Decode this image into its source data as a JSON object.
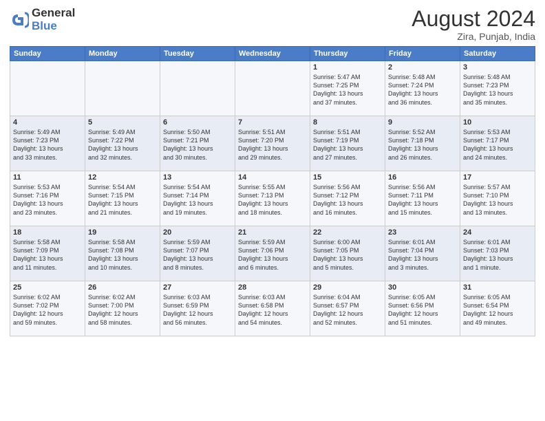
{
  "header": {
    "logo_line1": "General",
    "logo_line2": "Blue",
    "month": "August 2024",
    "location": "Zira, Punjab, India"
  },
  "weekdays": [
    "Sunday",
    "Monday",
    "Tuesday",
    "Wednesday",
    "Thursday",
    "Friday",
    "Saturday"
  ],
  "weeks": [
    [
      {
        "day": "",
        "info": ""
      },
      {
        "day": "",
        "info": ""
      },
      {
        "day": "",
        "info": ""
      },
      {
        "day": "",
        "info": ""
      },
      {
        "day": "1",
        "info": "Sunrise: 5:47 AM\nSunset: 7:25 PM\nDaylight: 13 hours\nand 37 minutes."
      },
      {
        "day": "2",
        "info": "Sunrise: 5:48 AM\nSunset: 7:24 PM\nDaylight: 13 hours\nand 36 minutes."
      },
      {
        "day": "3",
        "info": "Sunrise: 5:48 AM\nSunset: 7:23 PM\nDaylight: 13 hours\nand 35 minutes."
      }
    ],
    [
      {
        "day": "4",
        "info": "Sunrise: 5:49 AM\nSunset: 7:23 PM\nDaylight: 13 hours\nand 33 minutes."
      },
      {
        "day": "5",
        "info": "Sunrise: 5:49 AM\nSunset: 7:22 PM\nDaylight: 13 hours\nand 32 minutes."
      },
      {
        "day": "6",
        "info": "Sunrise: 5:50 AM\nSunset: 7:21 PM\nDaylight: 13 hours\nand 30 minutes."
      },
      {
        "day": "7",
        "info": "Sunrise: 5:51 AM\nSunset: 7:20 PM\nDaylight: 13 hours\nand 29 minutes."
      },
      {
        "day": "8",
        "info": "Sunrise: 5:51 AM\nSunset: 7:19 PM\nDaylight: 13 hours\nand 27 minutes."
      },
      {
        "day": "9",
        "info": "Sunrise: 5:52 AM\nSunset: 7:18 PM\nDaylight: 13 hours\nand 26 minutes."
      },
      {
        "day": "10",
        "info": "Sunrise: 5:53 AM\nSunset: 7:17 PM\nDaylight: 13 hours\nand 24 minutes."
      }
    ],
    [
      {
        "day": "11",
        "info": "Sunrise: 5:53 AM\nSunset: 7:16 PM\nDaylight: 13 hours\nand 23 minutes."
      },
      {
        "day": "12",
        "info": "Sunrise: 5:54 AM\nSunset: 7:15 PM\nDaylight: 13 hours\nand 21 minutes."
      },
      {
        "day": "13",
        "info": "Sunrise: 5:54 AM\nSunset: 7:14 PM\nDaylight: 13 hours\nand 19 minutes."
      },
      {
        "day": "14",
        "info": "Sunrise: 5:55 AM\nSunset: 7:13 PM\nDaylight: 13 hours\nand 18 minutes."
      },
      {
        "day": "15",
        "info": "Sunrise: 5:56 AM\nSunset: 7:12 PM\nDaylight: 13 hours\nand 16 minutes."
      },
      {
        "day": "16",
        "info": "Sunrise: 5:56 AM\nSunset: 7:11 PM\nDaylight: 13 hours\nand 15 minutes."
      },
      {
        "day": "17",
        "info": "Sunrise: 5:57 AM\nSunset: 7:10 PM\nDaylight: 13 hours\nand 13 minutes."
      }
    ],
    [
      {
        "day": "18",
        "info": "Sunrise: 5:58 AM\nSunset: 7:09 PM\nDaylight: 13 hours\nand 11 minutes."
      },
      {
        "day": "19",
        "info": "Sunrise: 5:58 AM\nSunset: 7:08 PM\nDaylight: 13 hours\nand 10 minutes."
      },
      {
        "day": "20",
        "info": "Sunrise: 5:59 AM\nSunset: 7:07 PM\nDaylight: 13 hours\nand 8 minutes."
      },
      {
        "day": "21",
        "info": "Sunrise: 5:59 AM\nSunset: 7:06 PM\nDaylight: 13 hours\nand 6 minutes."
      },
      {
        "day": "22",
        "info": "Sunrise: 6:00 AM\nSunset: 7:05 PM\nDaylight: 13 hours\nand 5 minutes."
      },
      {
        "day": "23",
        "info": "Sunrise: 6:01 AM\nSunset: 7:04 PM\nDaylight: 13 hours\nand 3 minutes."
      },
      {
        "day": "24",
        "info": "Sunrise: 6:01 AM\nSunset: 7:03 PM\nDaylight: 13 hours\nand 1 minute."
      }
    ],
    [
      {
        "day": "25",
        "info": "Sunrise: 6:02 AM\nSunset: 7:02 PM\nDaylight: 12 hours\nand 59 minutes."
      },
      {
        "day": "26",
        "info": "Sunrise: 6:02 AM\nSunset: 7:00 PM\nDaylight: 12 hours\nand 58 minutes."
      },
      {
        "day": "27",
        "info": "Sunrise: 6:03 AM\nSunset: 6:59 PM\nDaylight: 12 hours\nand 56 minutes."
      },
      {
        "day": "28",
        "info": "Sunrise: 6:03 AM\nSunset: 6:58 PM\nDaylight: 12 hours\nand 54 minutes."
      },
      {
        "day": "29",
        "info": "Sunrise: 6:04 AM\nSunset: 6:57 PM\nDaylight: 12 hours\nand 52 minutes."
      },
      {
        "day": "30",
        "info": "Sunrise: 6:05 AM\nSunset: 6:56 PM\nDaylight: 12 hours\nand 51 minutes."
      },
      {
        "day": "31",
        "info": "Sunrise: 6:05 AM\nSunset: 6:54 PM\nDaylight: 12 hours\nand 49 minutes."
      }
    ]
  ]
}
